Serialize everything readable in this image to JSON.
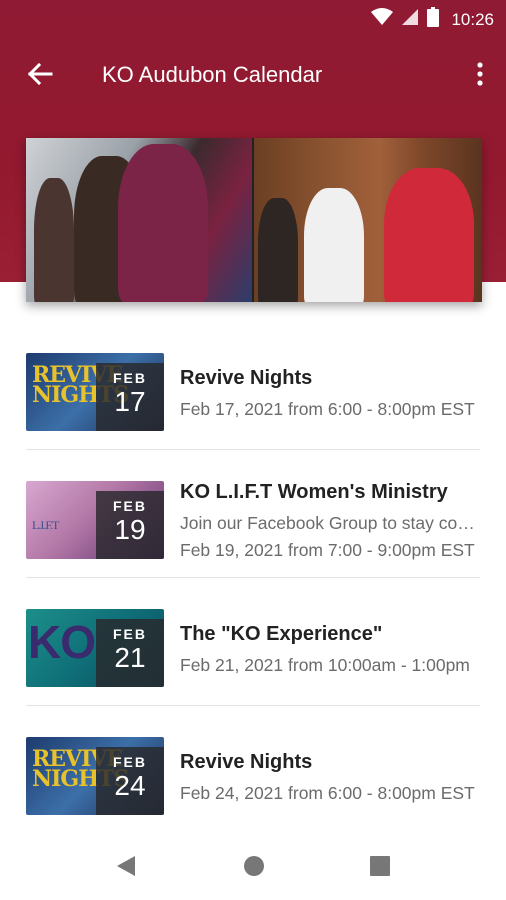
{
  "colors": {
    "header": "#93192f",
    "text": "#222222",
    "subtext": "#6b6b6b"
  },
  "status_bar": {
    "time": "10:26",
    "icons": [
      "wifi-icon",
      "signal-icon",
      "battery-icon"
    ]
  },
  "app_bar": {
    "title": "KO Audubon Calendar",
    "back_icon": "arrow-left-icon",
    "menu_icon": "more-vert-icon"
  },
  "events": [
    {
      "title": "Revive Nights",
      "lines": [
        "Feb 17, 2021 from 6:00 - 8:00pm EST"
      ],
      "month": "FEB",
      "day": "17",
      "thumb_text": "REVIVE NIGHTS"
    },
    {
      "title": "KO L.I.F.T Women's Ministry",
      "lines": [
        "Join our Facebook Group to stay connected",
        "Feb 19, 2021 from 7:00 - 9:00pm EST"
      ],
      "month": "FEB",
      "day": "19",
      "thumb_text": "L.I.F.T"
    },
    {
      "title": "The \"KO Experience\"",
      "lines": [
        "Feb 21, 2021 from 10:00am - 1:00pm"
      ],
      "month": "FEB",
      "day": "21",
      "thumb_text": "KO"
    },
    {
      "title": "Revive Nights",
      "lines": [
        "Feb 24, 2021 from 6:00 - 8:00pm EST"
      ],
      "month": "FEB",
      "day": "24",
      "thumb_text": "REVIVE NIGHTS"
    }
  ],
  "nav_bar": {
    "icons": [
      "back-triangle-icon",
      "home-circle-icon",
      "recents-square-icon"
    ]
  }
}
